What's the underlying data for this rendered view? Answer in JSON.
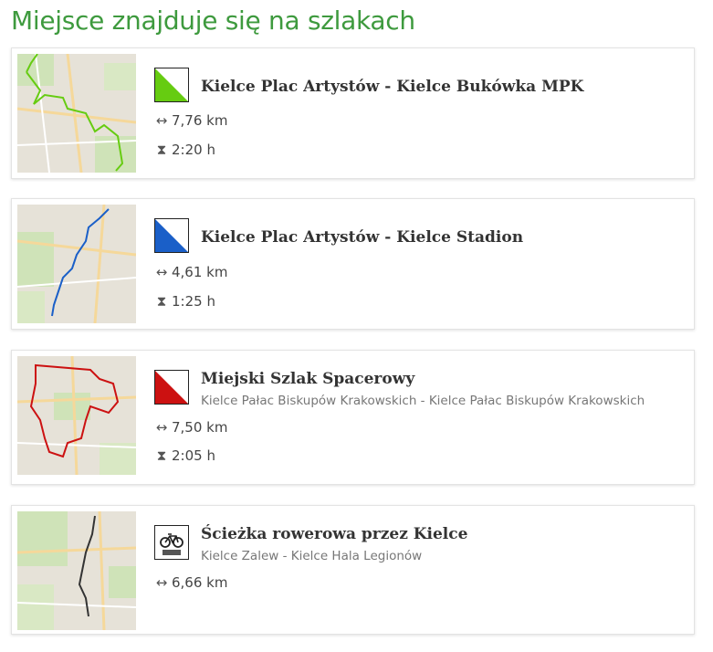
{
  "heading": "Miejsce znajduje się na szlakach",
  "trails": [
    {
      "title": "Kielce Plac Artystów - Kielce Bukówka MPK",
      "subtitle": "",
      "distance": "7,76 km",
      "duration": "2:20 h",
      "color": "#66cc11",
      "badge": "green-marker-icon"
    },
    {
      "title": "Kielce Plac Artystów - Kielce Stadion",
      "subtitle": "",
      "distance": "4,61 km",
      "duration": "1:25 h",
      "color": "#1a5fc8",
      "badge": "blue-marker-icon"
    },
    {
      "title": "Miejski Szlak Spacerowy",
      "subtitle": "Kielce Pałac Biskupów Krakowskich - Kielce Pałac Biskupów Krakowskich",
      "distance": "7,50 km",
      "duration": "2:05 h",
      "color": "#cc1111",
      "badge": "red-marker-icon"
    },
    {
      "title": "Ścieżka rowerowa przez Kielce",
      "subtitle": "Kielce Zalew - Kielce Hala Legionów",
      "distance": "6,66 km",
      "duration": "",
      "color": "#333333",
      "badge": "bicycle-icon"
    }
  ],
  "icons": {
    "distance": "↔",
    "duration": "⧗"
  }
}
